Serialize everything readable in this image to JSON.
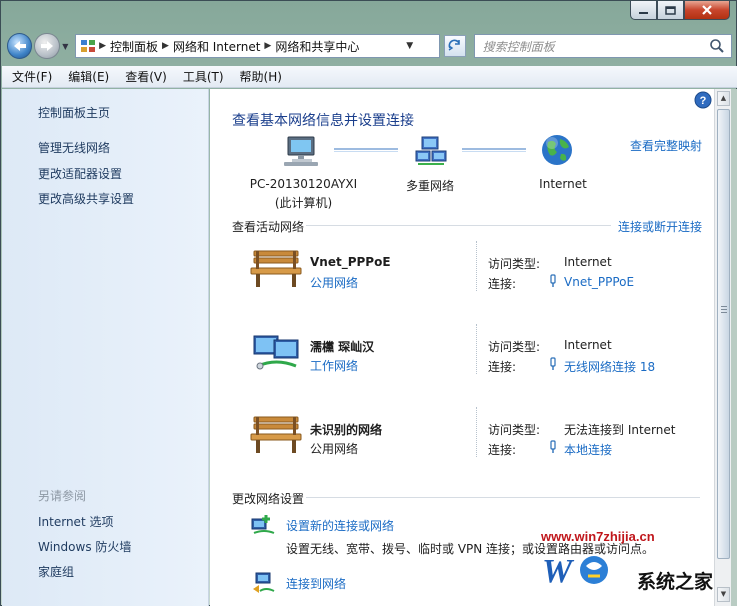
{
  "window": {
    "caption_buttons": [
      "minimize-icon",
      "maximize-icon",
      "close-icon"
    ]
  },
  "nav": {
    "breadcrumbs": [
      "控制面板",
      "网络和 Internet",
      "网络和共享中心"
    ],
    "search_placeholder": "搜索控制面板"
  },
  "menu": [
    "文件(F)",
    "编辑(E)",
    "查看(V)",
    "工具(T)",
    "帮助(H)"
  ],
  "left_pane": {
    "home": "控制面板主页",
    "links": [
      "管理无线网络",
      "更改适配器设置",
      "更改高级共享设置"
    ],
    "see_also_title": "另请参阅",
    "see_also": [
      "Internet 选项",
      "Windows 防火墙",
      "家庭组"
    ]
  },
  "main": {
    "title": "查看基本网络信息并设置连接",
    "full_map_link": "查看完整映射",
    "map": {
      "computer_name": "PC-20130120AYXI",
      "computer_note": "(此计算机)",
      "middle": "多重网络",
      "internet": "Internet"
    },
    "active_title": "查看活动网络",
    "connect_link": "连接或断开连接",
    "access_type_label": "访问类型:",
    "connection_label": "连接:",
    "networks": [
      {
        "name": "Vnet_PPPoE",
        "category": "公用网络",
        "category_is_link": true,
        "access": "Internet",
        "connection": "Vnet_PPPoE",
        "icon": "park-bench-icon"
      },
      {
        "name": "濡欓   琛屾汉",
        "category": "工作网络",
        "category_is_link": true,
        "access": "Internet",
        "connection": "无线网络连接 18",
        "icon": "work-network-icon"
      },
      {
        "name": "未识别的网络",
        "category": "公用网络",
        "category_is_link": false,
        "access": "无法连接到 Internet",
        "connection": "本地连接",
        "icon": "park-bench-icon"
      }
    ],
    "change_title": "更改网络设置",
    "tasks": [
      {
        "label": "设置新的连接或网络",
        "desc": "设置无线、宽带、拨号、临时或 VPN 连接；或设置路由器或访问点。"
      },
      {
        "label": "连接到网络",
        "desc": ""
      }
    ]
  },
  "watermark": {
    "url": "www.win7zhijia.cn",
    "brand": "系统之家"
  },
  "colors": {
    "link": "#1a6bc4",
    "heading": "#1a3e8c",
    "left_pane": "#dde9f6"
  }
}
